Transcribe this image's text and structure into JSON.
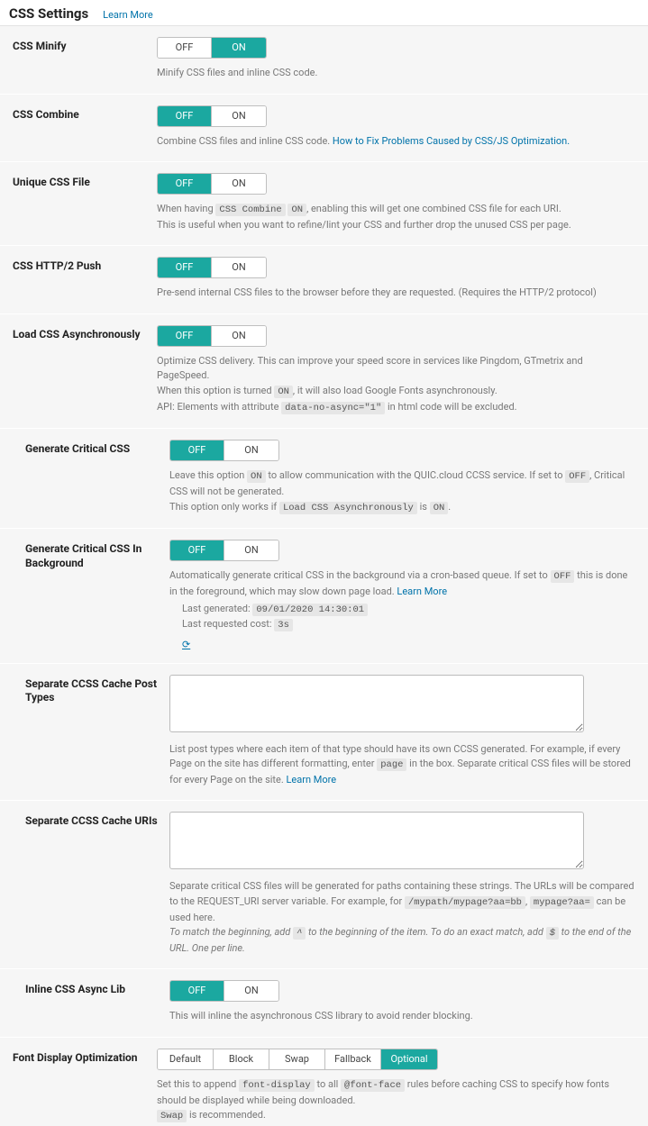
{
  "header": {
    "title": "CSS Settings",
    "learn_more": "Learn More"
  },
  "minify": {
    "label": "CSS Minify",
    "off": "OFF",
    "on": "ON",
    "state": "on",
    "desc": "Minify CSS files and inline CSS code."
  },
  "combine": {
    "label": "CSS Combine",
    "off": "OFF",
    "on": "ON",
    "state": "off",
    "desc_a": "Combine CSS files and inline CSS code. ",
    "link": "How to Fix Problems Caused by CSS/JS Optimization."
  },
  "unique": {
    "label": "Unique CSS File",
    "off": "OFF",
    "on": "ON",
    "state": "off",
    "d1a": "When having ",
    "d1c1": "CSS Combine",
    "d1b": " ",
    "d1c2": "ON",
    "d1c": ", enabling this will get one combined CSS file for each URI.",
    "d2": "This is useful when you want to refine/lint your CSS and further drop the unused CSS per page."
  },
  "http2": {
    "label": "CSS HTTP/2 Push",
    "off": "OFF",
    "on": "ON",
    "state": "off",
    "desc": "Pre-send internal CSS files to the browser before they are requested. (Requires the HTTP/2 protocol)"
  },
  "async": {
    "label": "Load CSS Asynchronously",
    "off": "OFF",
    "on": "ON",
    "state": "off",
    "d1": "Optimize CSS delivery. This can improve your speed score in services like Pingdom, GTmetrix and PageSpeed.",
    "d2a": "When this option is turned ",
    "d2c": "ON",
    "d2b": ", it will also load Google Fonts asynchronously.",
    "d3a": "API: Elements with attribute ",
    "d3c": "data-no-async=\"1\"",
    "d3b": " in html code will be excluded."
  },
  "gencc": {
    "label": "Generate Critical CSS",
    "off": "OFF",
    "on": "ON",
    "state": "off",
    "d1a": "Leave this option ",
    "d1c1": "ON",
    "d1b": " to allow communication with the QUIC.cloud CCSS service. If set to ",
    "d1c2": "OFF",
    "d1c": ", Critical CSS will not be generated.",
    "d2a": "This option only works if ",
    "d2c1": "Load CSS Asynchronously",
    "d2b": " is ",
    "d2c2": "ON",
    "d2c": "."
  },
  "genccbg": {
    "label": "Generate Critical CSS In Background",
    "off": "OFF",
    "on": "ON",
    "state": "off",
    "d1a": "Automatically generate critical CSS in the background via a cron-based queue. If set to ",
    "d1c": "OFF",
    "d1b": " this is done in the foreground, which may slow down page load. ",
    "link": "Learn More",
    "lg_label": "Last generated: ",
    "lg_val": "09/01/2020 14:30:01",
    "lc_label": "Last requested cost: ",
    "lc_val": "3s",
    "reload": "⟳"
  },
  "sepcache": {
    "label": "Separate CCSS Cache Post Types",
    "value": "",
    "d1a": "List post types where each item of that type should have its own CCSS generated. For example, if every Page on the site has different formatting, enter ",
    "d1c": "page",
    "d1b": " in the box. Separate critical CSS files will be stored for every Page on the site. ",
    "link": "Learn More"
  },
  "sepuri": {
    "label": "Separate CCSS Cache URIs",
    "value": "",
    "d1a": "Separate critical CSS files will be generated for paths containing these strings. The URLs will be compared to the REQUEST_URI server variable. For example, for ",
    "d1c1": "/mypath/mypage?aa=bb",
    "d1b": ", ",
    "d1c2": "mypage?aa=",
    "d1c": " can be used here.",
    "d2a": "To match the beginning, add ",
    "d2c1": "^",
    "d2b": " to the beginning of the item. To do an exact match, add ",
    "d2c2": "$",
    "d2c": " to the end of the URL. One per line."
  },
  "inline": {
    "label": "Inline CSS Async Lib",
    "off": "OFF",
    "on": "ON",
    "state": "off",
    "desc": "This will inline the asynchronous CSS library to avoid render blocking."
  },
  "font": {
    "label": "Font Display Optimization",
    "opts": [
      "Default",
      "Block",
      "Swap",
      "Fallback",
      "Optional"
    ],
    "active": 4,
    "d1a": "Set this to append ",
    "d1c1": "font-display",
    "d1b": " to all ",
    "d1c2": "@font-face",
    "d1c": " rules before caching CSS to specify how fonts should be displayed while being downloaded.",
    "d2c": "Swap",
    "d2b": " is recommended."
  }
}
